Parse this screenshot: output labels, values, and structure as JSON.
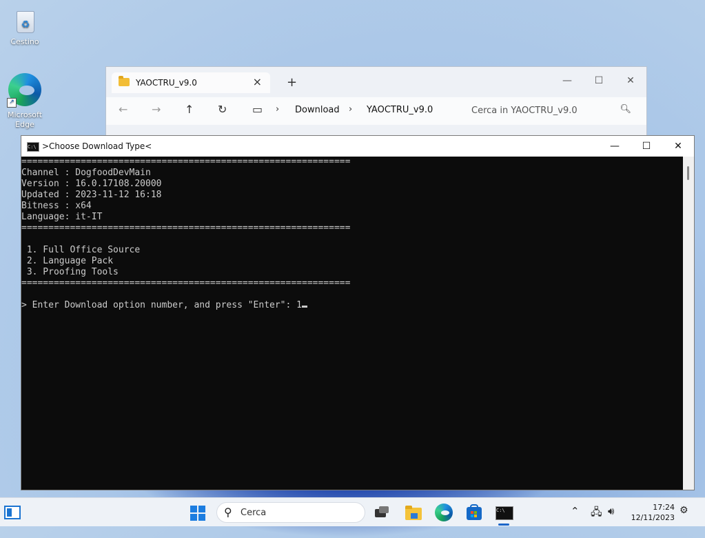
{
  "desktop": {
    "icons": [
      {
        "label": "Cestino",
        "icon": "recycle-bin-icon"
      },
      {
        "label": "Microsoft\nEdge",
        "icon": "edge-icon"
      }
    ]
  },
  "explorer": {
    "tab_title": "YAOCTRU_v9.0",
    "breadcrumb": [
      "Download",
      "YAOCTRU_v9.0"
    ],
    "search_placeholder": "Cerca in YAOCTRU_v9.0"
  },
  "console": {
    "title": ">Choose Download Type<",
    "lines": [
      "=============================================================",
      "Channel : DogfoodDevMain",
      "Version : 16.0.17108.20000",
      "Updated : 2023-11-12 16:18",
      "Bitness : x64",
      "Language: it-IT",
      "=============================================================",
      "",
      " 1. Full Office Source",
      " 2. Language Pack",
      " 3. Proofing Tools",
      "=============================================================",
      ""
    ],
    "prompt": "> Enter Download option number, and press \"Enter\": 1"
  },
  "taskbar": {
    "search_label": "Cerca",
    "time": "17:24",
    "date": "12/11/2023",
    "apps": [
      "task-view-icon",
      "file-explorer-icon",
      "edge-icon",
      "store-icon",
      "terminal-icon"
    ]
  }
}
